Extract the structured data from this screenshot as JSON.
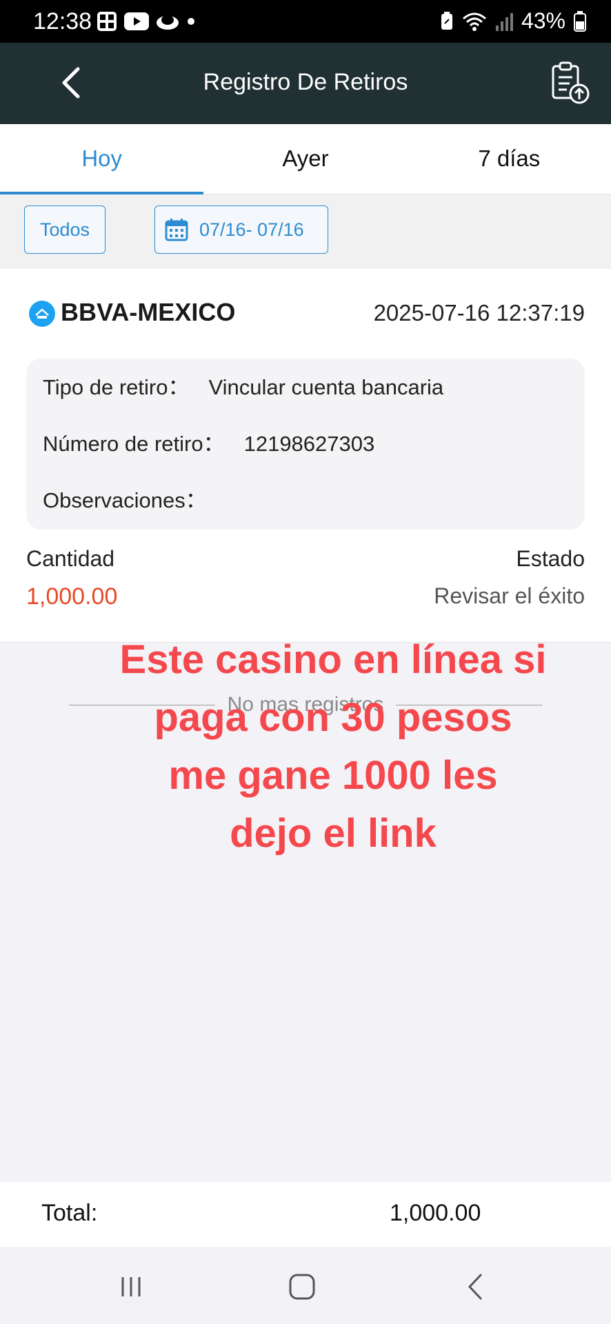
{
  "status_bar": {
    "time": "12:38",
    "battery": "43%",
    "left_icons": [
      "app-grid-icon",
      "youtube-icon",
      "cloud-icon",
      "dot-icon"
    ],
    "right_icons": [
      "battery-saver-icon",
      "wifi-icon",
      "signal-icon",
      "battery-icon"
    ]
  },
  "header": {
    "title": "Registro De Retiros",
    "back_icon": "chevron-left-icon",
    "action_icon": "clipboard-upload-icon"
  },
  "tabs": [
    {
      "label": "Hoy",
      "active": true
    },
    {
      "label": "Ayer",
      "active": false
    },
    {
      "label": "7 días",
      "active": false
    }
  ],
  "filters": {
    "all_label": "Todos",
    "date_range": "07/16- 07/16",
    "date_icon": "calendar-icon"
  },
  "record": {
    "bank": "BBVA-MEXICO",
    "datetime": "2025-07-16 12:37:19",
    "details": [
      {
        "label": "Tipo de retiro：",
        "value": "Vincular cuenta bancaria"
      },
      {
        "label": "Número de retiro：",
        "value": "12198627303"
      },
      {
        "label": "Observaciones：",
        "value": ""
      }
    ],
    "amount_label": "Cantidad",
    "amount": "1,000.00",
    "status_label": "Estado",
    "status": "Revisar el éxito"
  },
  "no_more": "No mas registros",
  "overlay_lines": [
    "Este casino en línea si",
    "paga con 30 pesos",
    "me gane 1000 les",
    "dejo el link"
  ],
  "total": {
    "label": "Total:",
    "value": "1,000.00"
  },
  "nav": {
    "icons": [
      "recent-apps-icon",
      "home-icon",
      "back-icon"
    ]
  },
  "colors": {
    "header_bg": "#213133",
    "accent": "#2d8bd1",
    "amount": "#e64a26",
    "overlay_text": "#f4484d"
  }
}
